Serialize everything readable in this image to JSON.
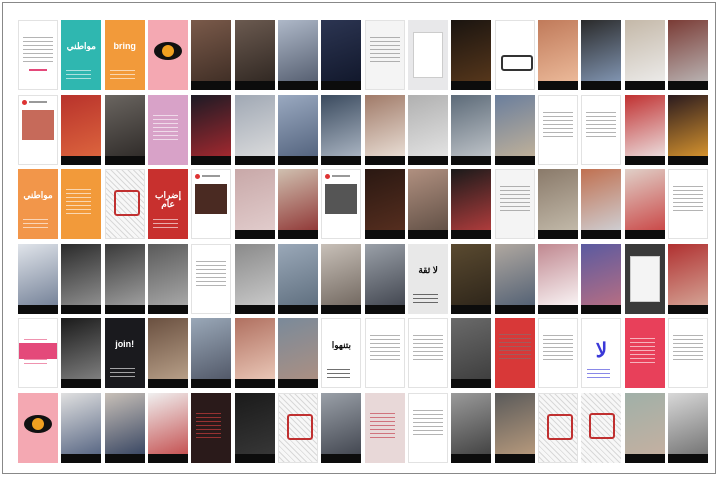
{
  "collage": {
    "tiles": [
      {
        "bg": "#ffffff",
        "style": "lines",
        "accent": "#e4497a"
      },
      {
        "bg": "#2fb7b0",
        "style": "poster",
        "text": "مواطني",
        "fg": "#ffffff"
      },
      {
        "bg": "#f29a3a",
        "style": "poster",
        "text": "bring",
        "fg": "#ffffff"
      },
      {
        "bg": "#f4a8b2",
        "style": "eye"
      },
      {
        "bg": "#7a5a4a",
        "style": "photo",
        "c2": "#3a2a22"
      },
      {
        "bg": "#6b5a50",
        "style": "photo",
        "c2": "#2b231e"
      },
      {
        "bg": "#aeb8c8",
        "style": "photo",
        "c2": "#4d5668"
      },
      {
        "bg": "#2c3552",
        "style": "photo",
        "c2": "#0f1528"
      },
      {
        "bg": "#f4f4f4",
        "style": "lines"
      },
      {
        "bg": "#e8e8ea",
        "style": "card",
        "c2": "#ffffff"
      },
      {
        "bg": "#1a1410",
        "style": "photo",
        "c2": "#5c3a1c"
      },
      {
        "bg": "#ffffff",
        "style": "bus"
      },
      {
        "bg": "#c07a5a",
        "style": "photo",
        "c2": "#f0c0a0"
      },
      {
        "bg": "#2a2a2a",
        "style": "photo",
        "c2": "#8aa0c0"
      },
      {
        "bg": "#c4b8a8",
        "style": "photo",
        "c2": "#f0f0f0"
      },
      {
        "bg": "#7a3b35",
        "style": "photo",
        "c2": "#c0c0c0"
      },
      {
        "bg": "#ffffff",
        "style": "post",
        "c2": "#c66a5a"
      },
      {
        "bg": "#b8322b",
        "style": "photo",
        "c2": "#e06a40"
      },
      {
        "bg": "#6a6560",
        "style": "photo",
        "c2": "#2a2624"
      },
      {
        "bg": "#d8a2c8",
        "style": "poster",
        "text": "",
        "fg": "#ffffff"
      },
      {
        "bg": "#1c1a24",
        "style": "photo",
        "c2": "#b02a30"
      },
      {
        "bg": "#a0a8b4",
        "style": "photo",
        "c2": "#e0e0e0"
      },
      {
        "bg": "#9aa9c0",
        "style": "photo",
        "c2": "#4d5d78"
      },
      {
        "bg": "#3a4a5e",
        "style": "photo",
        "c2": "#b5bfcc"
      },
      {
        "bg": "#a07a68",
        "style": "photo",
        "c2": "#f0e8e0"
      },
      {
        "bg": "#b0b0b0",
        "style": "photo",
        "c2": "#e8e8e8"
      },
      {
        "bg": "#5c6a78",
        "style": "photo",
        "c2": "#c8ccd0"
      },
      {
        "bg": "#6a7e9c",
        "style": "photo",
        "c2": "#c8b69a"
      },
      {
        "bg": "#ffffff",
        "style": "lines"
      },
      {
        "bg": "#ffffff",
        "style": "lines"
      },
      {
        "bg": "#c03030",
        "style": "photo",
        "c2": "#f0f0f0"
      },
      {
        "bg": "#2a1a1e",
        "style": "photo",
        "c2": "#e8a030"
      },
      {
        "bg": "#f2964a",
        "style": "poster",
        "text": "مواطني",
        "fg": "#ffffff"
      },
      {
        "bg": "#f29a3a",
        "style": "poster",
        "text": "",
        "fg": "#ffffff"
      },
      {
        "bg": "#ffffff",
        "style": "drawing"
      },
      {
        "bg": "#c8302e",
        "style": "poster",
        "text": "إضراب عام",
        "fg": "#ffffff"
      },
      {
        "bg": "#ffffff",
        "style": "post",
        "c2": "#4a2a22"
      },
      {
        "bg": "#c8a8a8",
        "style": "photo",
        "c2": "#e4d0d0"
      },
      {
        "bg": "#d0c0b0",
        "style": "photo",
        "c2": "#8a2a2a"
      },
      {
        "bg": "#ffffff",
        "style": "post",
        "c2": "#555555"
      },
      {
        "bg": "#2a1812",
        "style": "photo",
        "c2": "#5a3020"
      },
      {
        "bg": "#b09080",
        "style": "photo",
        "c2": "#5a4a40"
      },
      {
        "bg": "#1a1a1a",
        "style": "photo",
        "c2": "#c04040"
      },
      {
        "bg": "#f4f4f4",
        "style": "lines"
      },
      {
        "bg": "#8a7a6a",
        "style": "photo",
        "c2": "#c8c0b0"
      },
      {
        "bg": "#c07050",
        "style": "photo",
        "c2": "#d0d8e0"
      },
      {
        "bg": "#e0d0c8",
        "style": "photo",
        "c2": "#c83a3a"
      },
      {
        "bg": "#ffffff",
        "style": "lines"
      },
      {
        "bg": "#e0e4ea",
        "style": "photo",
        "c2": "#6a7890"
      },
      {
        "bg": "#2a2a2a",
        "style": "photo",
        "c2": "#9a9a9a"
      },
      {
        "bg": "#3a3a3a",
        "style": "photo",
        "c2": "#aaaaaa"
      },
      {
        "bg": "#5a5a5a",
        "style": "photo",
        "c2": "#b0b0b0"
      },
      {
        "bg": "#ffffff",
        "style": "lines"
      },
      {
        "bg": "#8a8a8a",
        "style": "photo",
        "c2": "#d0d0d0"
      },
      {
        "bg": "#9aa8b8",
        "style": "photo",
        "c2": "#5a6a7a"
      },
      {
        "bg": "#c8c0b8",
        "style": "photo",
        "c2": "#6a6058"
      },
      {
        "bg": "#9aa0a8",
        "style": "photo",
        "c2": "#3a3e48"
      },
      {
        "bg": "#e8e8e8",
        "style": "poster",
        "text": "لا ثقة",
        "fg": "#111111"
      },
      {
        "bg": "#5a4a30",
        "style": "photo",
        "c2": "#2a2218"
      },
      {
        "bg": "#b0a8a0",
        "style": "photo",
        "c2": "#4a5a70"
      },
      {
        "bg": "#c08890",
        "style": "photo",
        "c2": "#ffffff"
      },
      {
        "bg": "#5a5aa0",
        "style": "photo",
        "c2": "#c07080"
      },
      {
        "bg": "#3a3a3a",
        "style": "card",
        "c2": "#f4f4f4"
      },
      {
        "bg": "#b03030",
        "style": "photo",
        "c2": "#d8b0a0"
      },
      {
        "bg": "#ffffff",
        "style": "poster",
        "text": "",
        "fg": "#e4497a",
        "band": "#e4497a"
      },
      {
        "bg": "#1a1a1a",
        "style": "photo",
        "c2": "#8a8a8a"
      },
      {
        "bg": "#1a1a1e",
        "style": "poster",
        "text": "join!",
        "fg": "#ffffff"
      },
      {
        "bg": "#6a5040",
        "style": "photo",
        "c2": "#c0a890"
      },
      {
        "bg": "#9aa8b8",
        "style": "photo",
        "c2": "#4a5060"
      },
      {
        "bg": "#b07060",
        "style": "photo",
        "c2": "#f0d0c0"
      },
      {
        "bg": "#7a8a9a",
        "style": "photo",
        "c2": "#b09080"
      },
      {
        "bg": "#ffffff",
        "style": "poster",
        "text": "بتنهوا",
        "fg": "#111111"
      },
      {
        "bg": "#ffffff",
        "style": "lines"
      },
      {
        "bg": "#ffffff",
        "style": "lines"
      },
      {
        "bg": "#6a6a6a",
        "style": "photo",
        "c2": "#3a3a3a"
      },
      {
        "bg": "#d83838",
        "style": "lines"
      },
      {
        "bg": "#ffffff",
        "style": "lines"
      },
      {
        "bg": "#ffffff",
        "style": "poster",
        "text": "لا",
        "fg": "#3a38d8"
      },
      {
        "bg": "#e8405a",
        "style": "poster",
        "text": "",
        "fg": "#ffffff"
      },
      {
        "bg": "#ffffff",
        "style": "lines"
      },
      {
        "bg": "#f4a8b2",
        "style": "eye"
      },
      {
        "bg": "#e0e0e0",
        "style": "photo",
        "c2": "#4a5a7a"
      },
      {
        "bg": "#c8c0b8",
        "style": "photo",
        "c2": "#2a3a5a"
      },
      {
        "bg": "#f0f0f0",
        "style": "photo",
        "c2": "#c04040"
      },
      {
        "bg": "#2a1a1a",
        "style": "poster",
        "text": "",
        "fg": "#e04040"
      },
      {
        "bg": "#1a1a1a",
        "style": "photo",
        "c2": "#3a3a3a"
      },
      {
        "bg": "#ffffff",
        "style": "drawing"
      },
      {
        "bg": "#9aa0a8",
        "style": "photo",
        "c2": "#3a3e48"
      },
      {
        "bg": "#e8d8d8",
        "style": "poster",
        "text": "",
        "fg": "#c03040"
      },
      {
        "bg": "#ffffff",
        "style": "lines"
      },
      {
        "bg": "#9a9a9a",
        "style": "photo",
        "c2": "#3a3a3a"
      },
      {
        "bg": "#5a5a5a",
        "style": "photo",
        "c2": "#c0a080"
      },
      {
        "bg": "#ffffff",
        "style": "drawing"
      },
      {
        "bg": "#f0e8e0",
        "style": "drawing"
      },
      {
        "bg": "#a0b0a8",
        "style": "photo",
        "c2": "#c8b0a0"
      },
      {
        "bg": "#d8d8d8",
        "style": "photo",
        "c2": "#6a6a6a"
      }
    ]
  }
}
